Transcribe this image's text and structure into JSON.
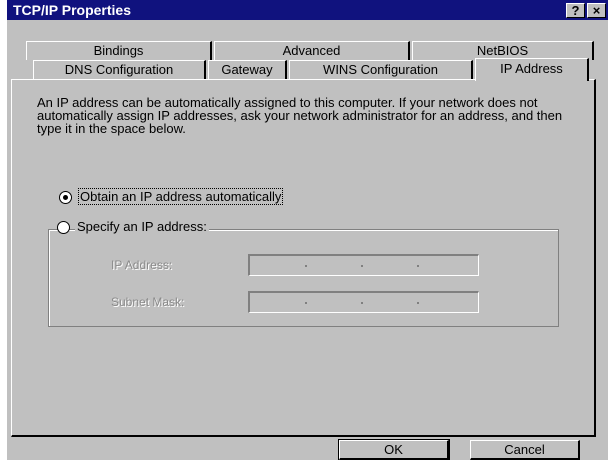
{
  "window": {
    "title": "TCP/IP Properties",
    "help_glyph": "?",
    "close_glyph": "×"
  },
  "tabs_back": [
    "Bindings",
    "Advanced",
    "NetBIOS"
  ],
  "tabs_front": [
    "DNS Configuration",
    "Gateway",
    "WINS Configuration",
    "IP Address"
  ],
  "description": "An IP address can be automatically assigned to this computer. If your network does not automatically assign IP addresses, ask your network administrator for an address, and then type it in the space below.",
  "options": {
    "obtain_auto": "Obtain an IP address automatically",
    "specify": "Specify an IP address:"
  },
  "fields": {
    "ip_label": "IP Address:",
    "subnet_label": "Subnet Mask:"
  },
  "buttons": {
    "ok": "OK",
    "cancel": "Cancel"
  }
}
